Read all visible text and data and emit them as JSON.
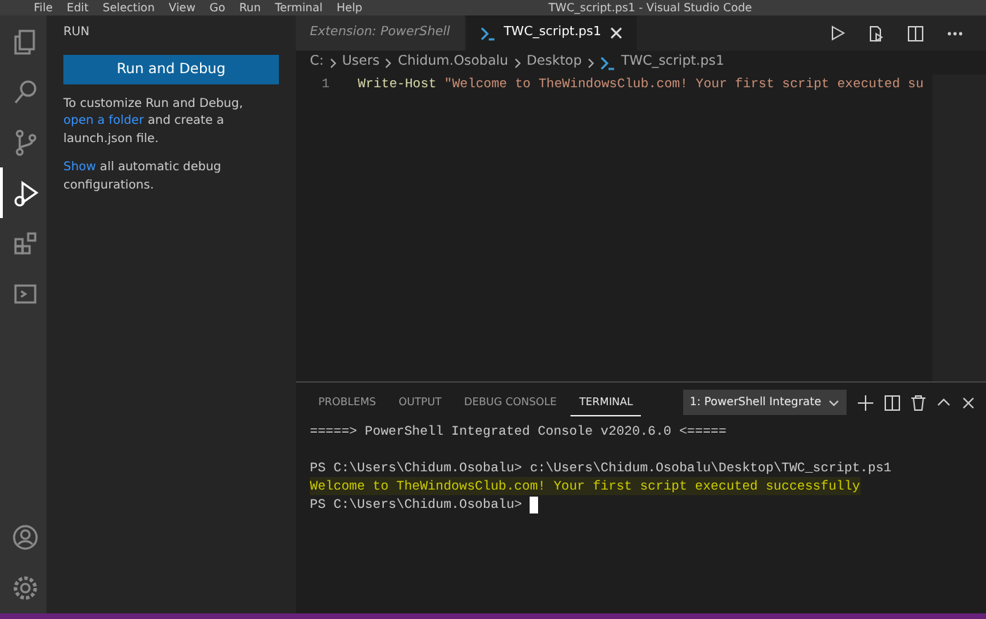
{
  "title_bar": {
    "menu": [
      "File",
      "Edit",
      "Selection",
      "View",
      "Go",
      "Run",
      "Terminal",
      "Help"
    ],
    "title": "TWC_script.ps1 - Visual Studio Code"
  },
  "activity_bar": [
    {
      "kind": "explorer",
      "selected": false
    },
    {
      "kind": "search",
      "selected": false
    },
    {
      "kind": "source-control",
      "selected": false
    },
    {
      "kind": "run",
      "selected": true
    },
    {
      "kind": "extensions",
      "selected": false
    },
    {
      "kind": "terminal",
      "selected": false
    },
    {
      "kind": "account",
      "selected": false
    },
    {
      "kind": "settings",
      "selected": false
    }
  ],
  "sidebar": {
    "title": "RUN",
    "button": "Run and Debug",
    "paragraphs": [
      [
        {
          "text": "To customize Run and Debug, ",
          "link": false
        },
        {
          "text": "open a folder",
          "link": true
        },
        {
          "text": " and create a launch.json file.",
          "link": false
        }
      ],
      [
        {
          "text": "Show",
          "link": true
        },
        {
          "text": " all automatic debug configurations.",
          "link": false
        }
      ]
    ]
  },
  "tabs": [
    {
      "label": "Extension: PowerShell",
      "selected": false,
      "preview": true
    },
    {
      "label": "TWC_script.ps1",
      "selected": true,
      "preview": false
    }
  ],
  "breadcrumb": [
    "C:",
    "Users",
    "Chidum.Osobalu",
    "Desktop",
    "TWC_script.ps1"
  ],
  "code": [
    {
      "number": "1",
      "tokens": [
        {
          "text": "Write-Host ",
          "kind": "command"
        },
        {
          "text": "\"Welcome to TheWindowsClub.com! Your first script executed su",
          "kind": "string"
        }
      ]
    }
  ],
  "panel": {
    "tabs": [
      {
        "label": "PROBLEMS",
        "selected": false
      },
      {
        "label": "OUTPUT",
        "selected": false
      },
      {
        "label": "DEBUG CONSOLE",
        "selected": false
      },
      {
        "label": "TERMINAL",
        "selected": true
      }
    ],
    "terminal_select": "1: PowerShell Integrate",
    "lines": [
      {
        "text": "=====> PowerShell Integrated Console v2020.6.0 <=====",
        "kind": "plain"
      },
      {
        "kind": "blank"
      },
      {
        "text": "PS C:\\Users\\Chidum.Osobalu> c:\\Users\\Chidum.Osobalu\\Desktop\\TWC_script.ps1",
        "kind": "plain"
      },
      {
        "text": "Welcome to TheWindowsClub.com! Your first script executed successfully",
        "kind": "output"
      },
      {
        "text": "PS C:\\Users\\Chidum.Osobalu> ",
        "kind": "prompt"
      }
    ]
  }
}
